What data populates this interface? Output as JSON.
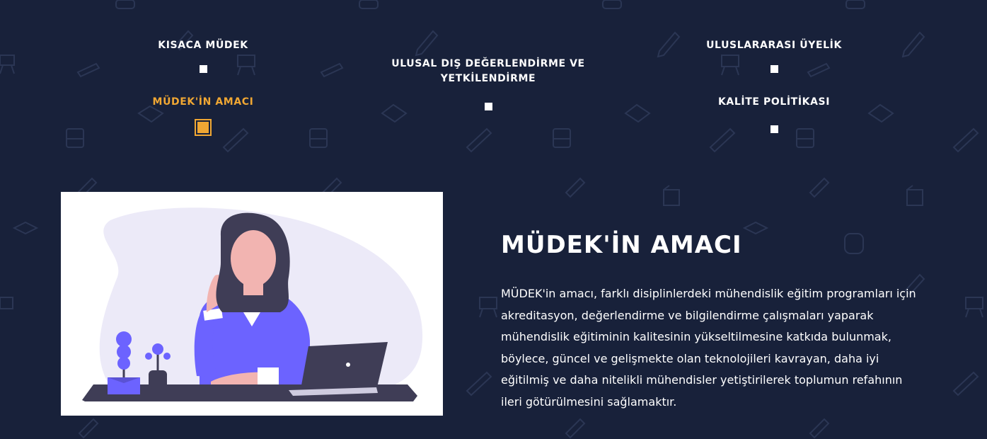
{
  "tabs": [
    {
      "label": "KISACA MÜDEK",
      "active": false
    },
    {
      "label": "MÜDEK'İN AMACI",
      "active": true
    },
    {
      "label": "ULUSAL DIŞ DEĞERLENDİRME VE YETKİLENDİRME",
      "active": false
    },
    {
      "label": "ULUSLARARASI ÜYELİK",
      "active": false
    },
    {
      "label": "KALİTE POLİTİKASI",
      "active": false
    }
  ],
  "content": {
    "title": "MÜDEK'İN AMACI",
    "body": "MÜDEK'in amacı, farklı disiplinlerdeki mühendislik eğitim programları için akreditasyon, değerlendirme ve bilgilendirme çalışmaları yaparak mühendislik eğitiminin kalitesinin yükseltilmesine katkıda bulunmak, böylece, güncel ve gelişmekte olan teknolojileri kavrayan, daha iyi eğitilmiş ve daha nitelikli mühendisler yetiştirilerek toplumun refahının ileri götürülmesini sağlamaktır."
  },
  "colors": {
    "background": "#18213a",
    "accent": "#f0a733",
    "pattern": "#2b3654",
    "illustration_purple": "#6c63ff"
  },
  "icons": [
    "pencil-icon",
    "book-icon",
    "graduation-cap-icon",
    "ruler-icon",
    "easel-icon",
    "backpack-icon",
    "cube-icon"
  ]
}
